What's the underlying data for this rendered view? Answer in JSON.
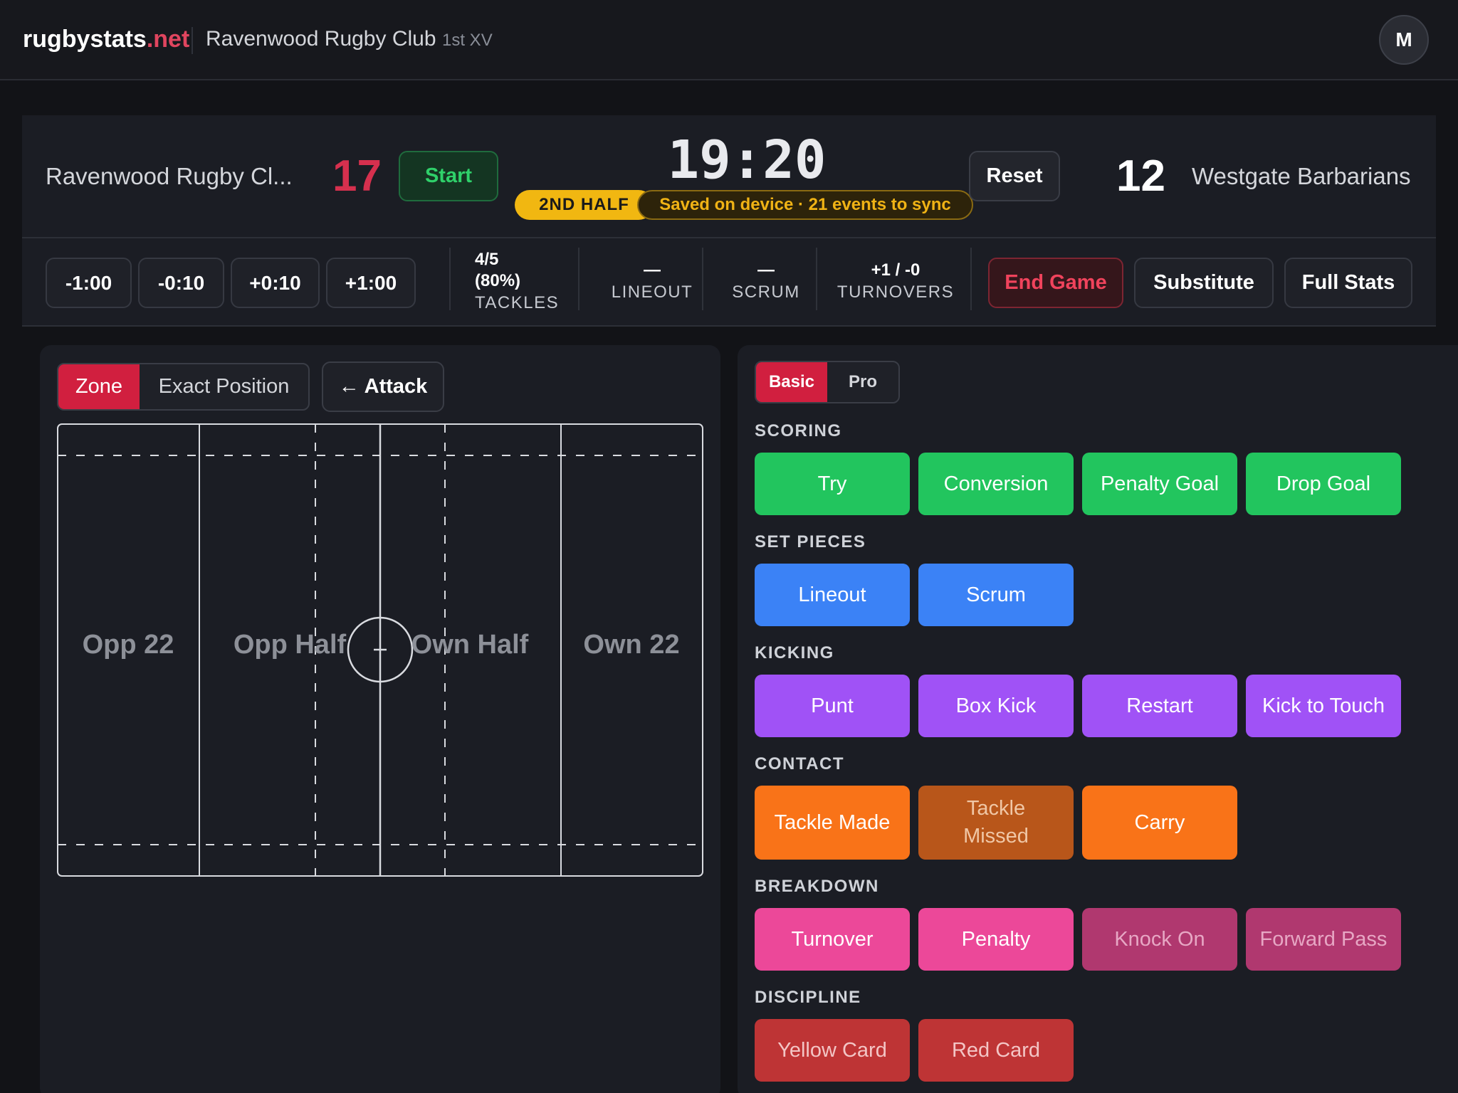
{
  "header": {
    "brand_main": "rugbystats",
    "brand_tld": ".net",
    "club_name": "Ravenwood Rugby Club",
    "team": "1st XV",
    "avatar_initial": "M"
  },
  "scoreboard": {
    "home_name": "Ravenwood Rugby Cl...",
    "home_score": "17",
    "start_label": "Start",
    "clock": "19:20",
    "half": "2ND HALF",
    "sync_status": "Saved on device · 21 events to sync",
    "reset_label": "Reset",
    "away_score": "12",
    "away_name": "Westgate Barbarians"
  },
  "controls": {
    "time_adjust": [
      "-1:00",
      "-0:10",
      "+0:10",
      "+1:00"
    ],
    "stats": {
      "tackles": {
        "value_line1": "4/5",
        "value_line2": "(80%)",
        "label": "TACKLES"
      },
      "lineout": {
        "value": "—",
        "label": "LINEOUT"
      },
      "scrum": {
        "value": "—",
        "label": "SCRUM"
      },
      "turnovers": {
        "value": "+1 / -0",
        "label": "TURNOVERS"
      }
    },
    "end_game": "End Game",
    "substitute": "Substitute",
    "full_stats": "Full Stats"
  },
  "pitch_panel": {
    "mode_zone": "Zone",
    "mode_exact": "Exact Position",
    "attack_label": "← Attack",
    "zones": [
      "Opp 22",
      "Opp Half",
      "Own Half",
      "Own 22"
    ]
  },
  "events_panel": {
    "tier_basic": "Basic",
    "tier_pro": "Pro",
    "sections": {
      "scoring": {
        "title": "SCORING",
        "buttons": [
          "Try",
          "Conversion",
          "Penalty Goal",
          "Drop Goal"
        ]
      },
      "set_pieces": {
        "title": "SET PIECES",
        "buttons": [
          "Lineout",
          "Scrum"
        ]
      },
      "kicking": {
        "title": "KICKING",
        "buttons": [
          "Punt",
          "Box Kick",
          "Restart",
          "Kick to Touch"
        ]
      },
      "contact": {
        "title": "CONTACT",
        "buttons": [
          "Tackle Made",
          "Tackle Missed",
          "Carry"
        ]
      },
      "breakdown": {
        "title": "BREAKDOWN",
        "buttons": [
          "Turnover",
          "Penalty",
          "Knock On",
          "Forward Pass"
        ]
      },
      "discipline": {
        "title": "DISCIPLINE",
        "buttons": [
          "Yellow Card",
          "Red Card"
        ]
      }
    }
  },
  "colors": {
    "brand_accent": "#e0455f",
    "home_score": "#d6304e",
    "scoring": "#22c55e",
    "set_pieces": "#3b82f6",
    "kicking": "#a052f6",
    "contact": "#f97318",
    "breakdown": "#ec4899",
    "discipline": "#be3435"
  }
}
